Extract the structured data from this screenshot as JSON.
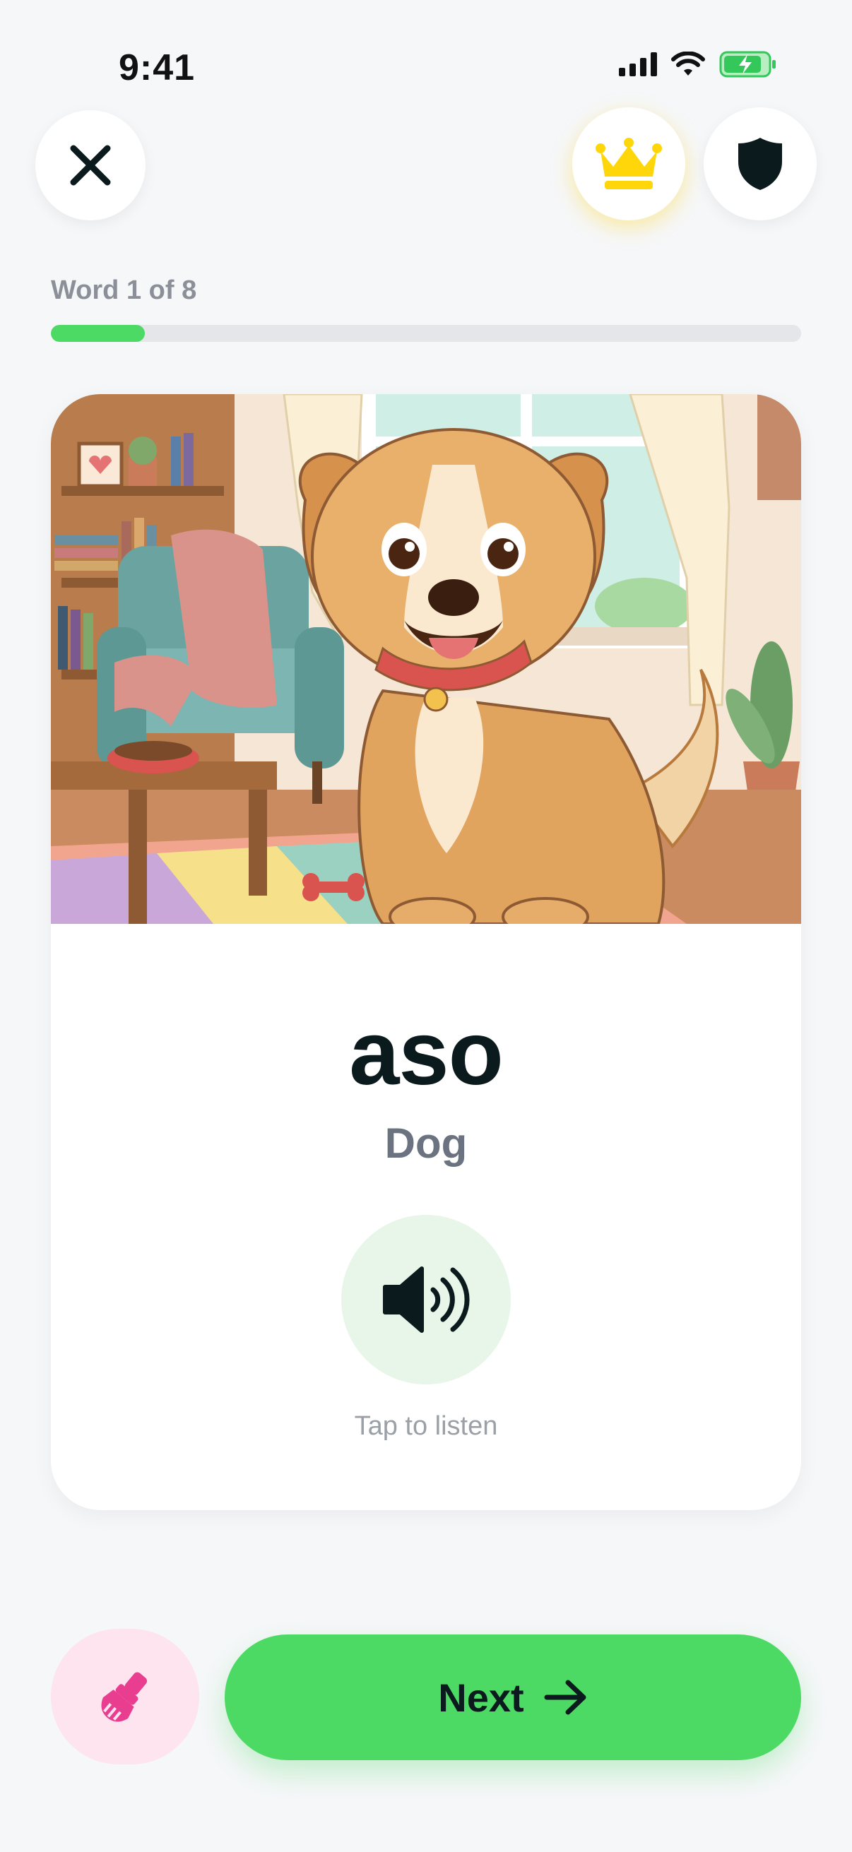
{
  "status_bar": {
    "time": "9:41"
  },
  "header": {
    "close_icon": "close-icon",
    "premium_icon": "crown-icon",
    "shield_icon": "shield-icon"
  },
  "progress": {
    "label": "Word 1 of 8",
    "current": 1,
    "total": 8,
    "fill_fraction": 0.125
  },
  "card": {
    "image_subject": "cartoon dog sitting in a cozy living room",
    "word": "aso",
    "translation": "Dog",
    "audio_icon": "speaker-icon",
    "tap_hint": "Tap to listen"
  },
  "footer": {
    "brush_icon": "paintbrush-icon",
    "next_label": "Next",
    "next_icon": "arrow-right-icon"
  },
  "colors": {
    "accent_green": "#4cd964",
    "crown_yellow": "#ffd60a",
    "brush_pink": "#e93e8f",
    "text_dark": "#0b1a1c"
  }
}
